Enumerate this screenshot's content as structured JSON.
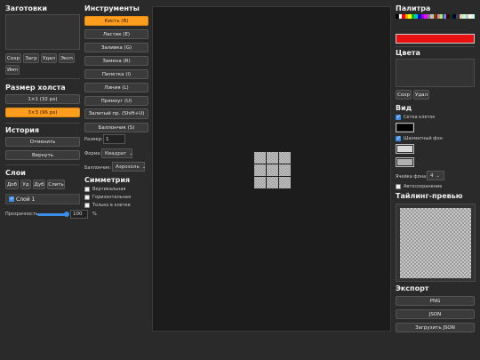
{
  "presets": {
    "title": "Заготовки",
    "buttons": [
      "Сохр",
      "Загр",
      "Удал",
      "Эксп",
      "Имп"
    ]
  },
  "canvas_size": {
    "title": "Размер холста",
    "options": [
      "1×1 (32 px)",
      "3×3 (96 px)"
    ]
  },
  "history": {
    "title": "История",
    "undo": "Отменить",
    "redo": "Вернуть"
  },
  "layers": {
    "title": "Слои",
    "buttons": [
      "Доб",
      "Уд",
      "Дуб",
      "Слить"
    ],
    "layer_name": "Слой 1",
    "opacity_label": "Прозрачность",
    "opacity_value": "100",
    "opacity_unit": "%",
    "opacity_fraction": 1.0
  },
  "tools": {
    "title": "Инструменты",
    "items": [
      "Кисть (B)",
      "Ластик (E)",
      "Заливка (G)",
      "Замена (R)",
      "Пипетка (I)",
      "Линия (L)",
      "Прямоуг (U)",
      "Залитый пр. (Shift+U)",
      "Баллончик (S)"
    ],
    "size_label": "Размер:",
    "size_value": "1",
    "shape_label": "Форма:",
    "shape_value": "Квадрат",
    "spray_label": "Баллончик:",
    "spray_value": "Аэрозоль"
  },
  "symmetry": {
    "title": "Симметрия",
    "options": [
      "Вертикальная",
      "Горизонтальная",
      "Только в клетке"
    ]
  },
  "palette": {
    "title": "Палитра",
    "current_color": "#e81010",
    "swatches": [
      "#000000",
      "#ffffff",
      "#ff0000",
      "#ffa500",
      "#ffff00",
      "#00c000",
      "#00c0c0",
      "#0000ff",
      "#8000ff",
      "#ff00ff",
      "#808080",
      "#c0c0c0",
      "#804000",
      "#ff8080",
      "#80ff80",
      "#8080ff",
      "#400000",
      "#004000",
      "#000040",
      "#404040",
      "#ffc0c0",
      "#c0ffc0",
      "#c0c0ff",
      "#ffffc0",
      "#c0ffff"
    ]
  },
  "colors": {
    "title": "Цвета",
    "buttons": [
      "Сохр",
      "Удал"
    ]
  },
  "view": {
    "title": "Вид",
    "cell_grid_label": "Сетка клеток",
    "cell_grid_color": "#000000",
    "checker_label": "Шахматный фон",
    "checker_color_a": "#d8d8d8",
    "checker_color_b": "#b0b0b0",
    "bg_cell_label": "Ячейка фона:",
    "bg_cell_value": "4",
    "autosave_label": "Автосохранение"
  },
  "tiling": {
    "title": "Тайлинг-превью"
  },
  "export": {
    "title": "Экспорт",
    "buttons": [
      "PNG",
      "JSON",
      "Загрузить JSON"
    ]
  }
}
